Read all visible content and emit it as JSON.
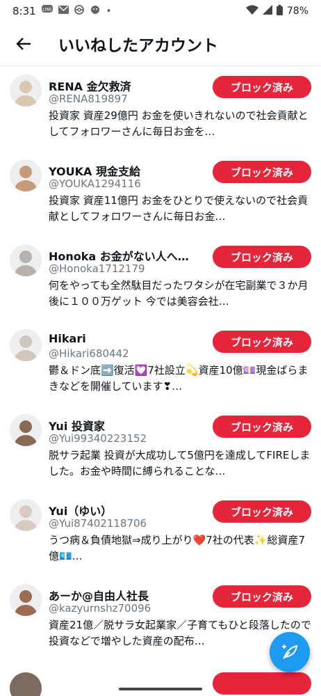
{
  "status_bar": {
    "time": "8:31",
    "battery": "78%",
    "notif_icons": [
      "line-icon",
      "mail-icon",
      "pokeball-icon",
      "chat-icon",
      "dot-icon"
    ]
  },
  "header": {
    "title": "いいねしたアカウント"
  },
  "button_label": "ブロック済み",
  "accounts": [
    {
      "name": "RENA 金欠救済",
      "handle": "@RENA819897",
      "bio": "投資家 資産29億円 お金を使いきれないので社会貢献としてフォロワーさんに毎日お金を…",
      "avatar_color": "#d9c7b0"
    },
    {
      "name": "YOUKA 現金支給",
      "handle": "@YOUKA1294116",
      "bio": "投資家 資産11億円 お金をひとりで使えないので社会貢献としてフォロワーさんに毎日お金…",
      "avatar_color": "#c79a78"
    },
    {
      "name": "Honoka お金がない人へ…",
      "handle": "@Honoka1712179",
      "bio": "何をやっても全然駄目だったワタシが在宅副業で３か月後に１００万ゲット 今では美容会社…",
      "avatar_color": "#b8b0aa"
    },
    {
      "name": "Hikari",
      "handle": "@Hikari680442",
      "bio": "鬱＆ドン底➡️復活💟7社設立💫資産10億💷現金ばらまきなどを開催しています❣…",
      "avatar_color": "#cfc6be"
    },
    {
      "name": "Yui 投資家",
      "handle": "@Yui99340223152",
      "bio": "脱サラ起業 投資が大成功して5億円を達成してFIREしました。お金や時間に縛られることな…",
      "avatar_color": "#8a6a55"
    },
    {
      "name": "Yui（ゆい）",
      "handle": "@Yui87402118706",
      "bio": "うつ病＆負債地獄⇒成り上がり❤️7社の代表✨総資産7億💶…",
      "avatar_color": "#d8cbc3"
    },
    {
      "name": "あーか@自由人社長",
      "handle": "@kazyurnshz70096",
      "bio": "資産21億／脱サラ女起業家／子育てもひと段落したので投資などで増やした資産の配布…",
      "avatar_color": "#9b6b52"
    }
  ],
  "fab_icon": "compose-tweet-icon"
}
